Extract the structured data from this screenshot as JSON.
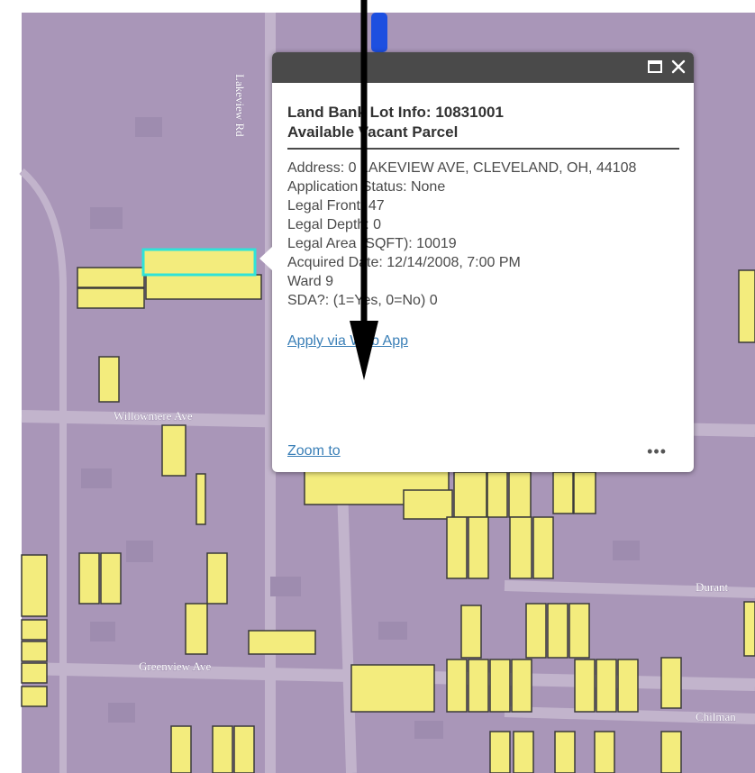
{
  "map": {
    "colors": {
      "background": "#a996b8",
      "street": "#c2b4cc",
      "parcel": "#f3ec7d",
      "parcel_outline": "#3a3a3a",
      "selected_outline": "#2fe3d8",
      "route": "#1d4fe0"
    },
    "street_labels": {
      "lakeview": "Lakeview Rd",
      "willowmere": "Willowmere Ave",
      "greenview": "Greenview Ave",
      "durant": "Durant",
      "chilman": "Chilman"
    }
  },
  "popup": {
    "title_line1": "Land Bank Lot Info: 10831001",
    "title_line2": "Available Vacant Parcel",
    "address": "Address: 0 LAKEVIEW AVE, CLEVELAND, OH, 44108",
    "application_status": "Application Status: None",
    "legal_front": "Legal Front: 47",
    "legal_depth": "Legal Depth: 0",
    "legal_area": "Legal Area (SQFT): 10019",
    "acquired_date": "Acquired Date: 12/14/2008, 7:00 PM",
    "ward": "Ward 9",
    "sda": "SDA?: (1=Yes, 0=No) 0",
    "apply_link": "Apply via Web App",
    "zoom_link": "Zoom to",
    "more_label": "•••",
    "maximize_icon": "maximize-icon",
    "close_icon": "close-icon"
  },
  "annotation": {
    "arrow_color": "#000000"
  }
}
